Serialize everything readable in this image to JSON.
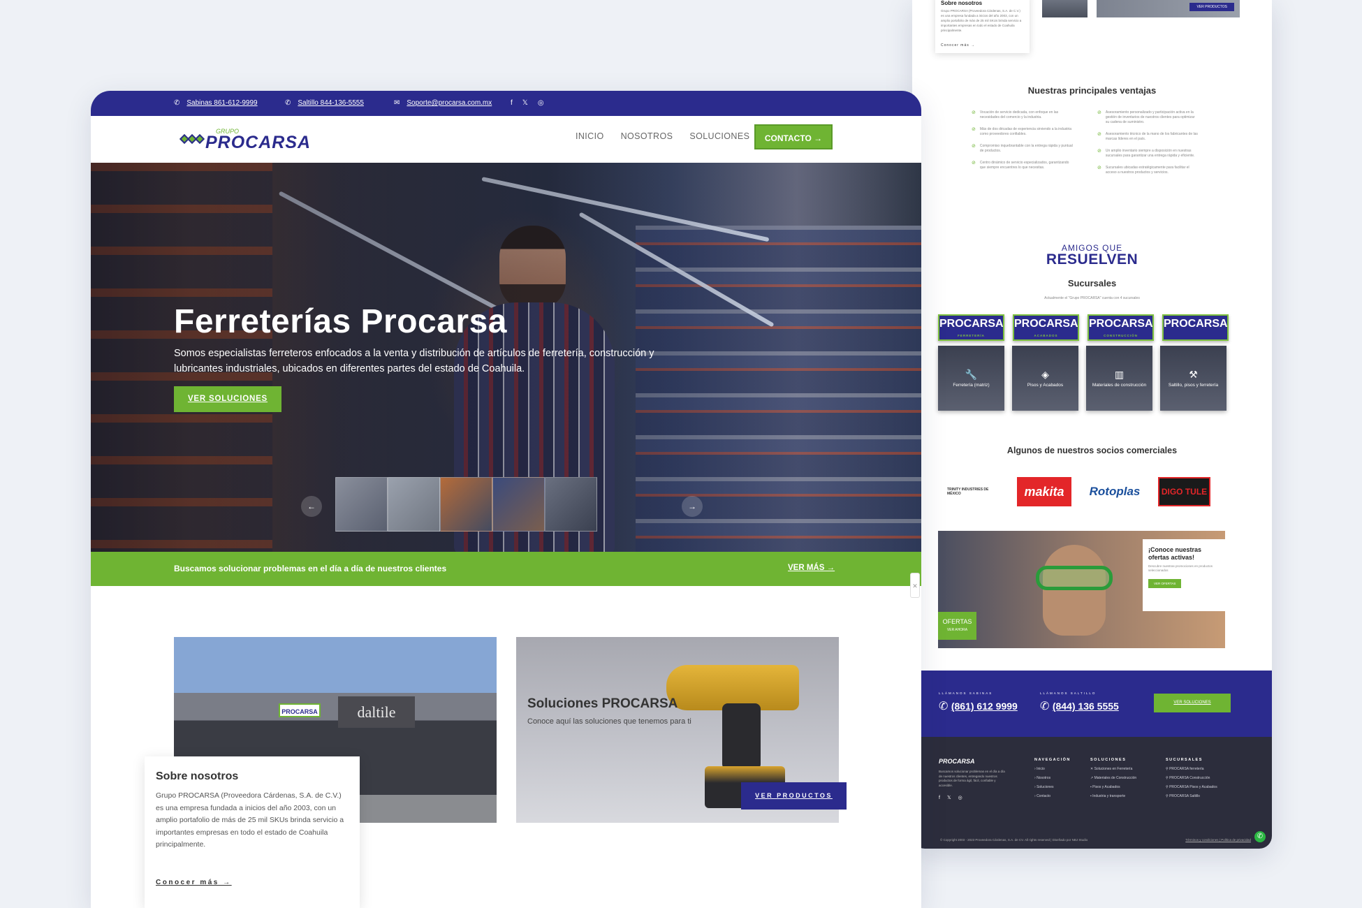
{
  "topbar": {
    "phone1": "Sabinas 861-612-9999",
    "phone2": "Saltillo 844-136-5555",
    "email": "Soporte@procarsa.com.mx"
  },
  "logo": {
    "small": "GRUPO",
    "big": "PROCARSA"
  },
  "nav": {
    "items": [
      "INICIO",
      "NOSOTROS",
      "SOLUCIONES"
    ],
    "contact": "CONTACTO →"
  },
  "hero": {
    "title": "Ferreterías Procarsa",
    "text": "Somos especialistas ferreteros enfocados a la venta y distribución de artículos de ferretería, construcción y lubricantes industriales, ubicados en diferentes partes del estado de Coahuila.",
    "button": "VER SOLUCIONES"
  },
  "greenbar": {
    "text": "Buscamos solucionar problemas en el día a día de nuestros clientes",
    "link": "VER MÁS →"
  },
  "solutions": {
    "title": "Soluciones PROCARSA",
    "text": "Conoce aquí las soluciones que tenemos para ti",
    "button": "VER PRODUCTOS",
    "store_sign": "PROCARSA",
    "store_brand": "daltile"
  },
  "about": {
    "title": "Sobre nosotros",
    "text": "Grupo PROCARSA (Proveedora Cárdenas, S.A. de C.V.) es una empresa fundada a inicios del año 2003, con un amplio portafolio de más de 25 mil SKUs brinda servicio a importantes empresas en todo el estado de Coahuila principalmente.",
    "link": "Conocer más →"
  },
  "right": {
    "about_title": "Sobre nosotros",
    "about_text": "Grupo PROCARSA (Proveedora Cárdenas, S.A. de C.V.) es una empresa fundada a inicios del año 2003, con un amplio portafolio de más de 25 mil SKUs brinda servicio a importantes empresas en todo el estado de Coahuila principalmente.",
    "about_link": "Conocer más →",
    "products_btn": "VER PRODUCTOS",
    "advantages_title": "Nuestras principales ventajas",
    "advantages_left": [
      "Vocación de servicio dedicada, con enfoque en las necesidades del comercio y la industria.",
      "Más de dos décadas de experiencia sirviendo a la industria como proveedores confiables.",
      "Compromiso inquebrantable con la entrega rápida y puntual de productos.",
      "Centro dinámico de servicio especializados, garantizando que siempre encuentres lo que necesitas."
    ],
    "advantages_right": [
      "Asesoramiento personalizado y participación activa en la gestión de inventarios de nuestros clientes para optimizar su cadena de suministro.",
      "Asesoramiento técnico de la mano de los fabricantes de las marcas líderes en el país.",
      "Un amplio inventario siempre a disposición en nuestras sucursales para garantizar una entrega rápida y eficiente.",
      "Sucursales ubicadas estratégicamente para facilitar el acceso a nuestros productos y servicios."
    ],
    "amigos_1": "AMIGOS QUE",
    "amigos_2": "RESUELVEN",
    "branches_title": "Sucursales",
    "branches_sub": "Actualmente el \"Grupo PROCARSA\" cuenta con 4 sucursales",
    "branch_logos": [
      {
        "name": "PROCARSA",
        "sub": "FERRETERÍA"
      },
      {
        "name": "PROCARSA",
        "sub": "ACABADOS"
      },
      {
        "name": "PROCARSA",
        "sub": "CONSTRUCCIÓN"
      },
      {
        "name": "PROCARSA",
        "sub": ""
      }
    ],
    "branch_cards": [
      "Ferretería (matriz)",
      "Pisos y Acabados",
      "Materiales de construcción",
      "Saltillo, pisos y ferretería"
    ],
    "partners_title": "Algunos de nuestros socios comerciales",
    "partners": [
      "TRINITY INDUSTRIES DE MÉXICO",
      "makita",
      "Rotoplas",
      "DIGO TULE"
    ],
    "promo_title": "¡Conoce nuestras ofertas activas!",
    "promo_text": "Descubre nuestras promociones en productos seleccionados",
    "promo_btn": "VER OFERTAS",
    "promo_tag": "OFERTAS",
    "promo_tag_sub": "VER AHORA",
    "call_sabinas_label": "LLÁMANOS SABINAS",
    "call_sabinas": "(861) 612 9999",
    "call_saltillo_label": "LLÁMANOS SALTILLO",
    "call_saltillo": "(844) 136 5555",
    "call_btn": "VER SOLUCIONES",
    "footer_text": "Buscamos solucionar problemas en el día a día de nuestros clientes, entregando nuestros productos de forma ágil, fácil, confiable y accesible.",
    "footer_nav_title": "NAVEGACIÓN",
    "footer_nav": [
      "Inicio",
      "Nosotros",
      "Soluciones",
      "Contacto"
    ],
    "footer_sol_title": "SOLUCIONES",
    "footer_sol": [
      "Soluciones en Ferretería",
      "Materiales de Construcción",
      "Pisos y Acabados",
      "Industria y transporte"
    ],
    "footer_suc_title": "SUCURSALES",
    "footer_suc": [
      "PROCARSA ferretería",
      "PROCARSA Construcción",
      "PROCARSA Pisos y Acabados",
      "PROCARSA Saltillo"
    ],
    "copyright": "© Copyright 2003 - 2023 Proveedora Cárdenas, S.A. de CV. All rights reserved | Diseñado por NBJ Studio",
    "policy": "Términos y condiciones | Política de privacidad"
  }
}
